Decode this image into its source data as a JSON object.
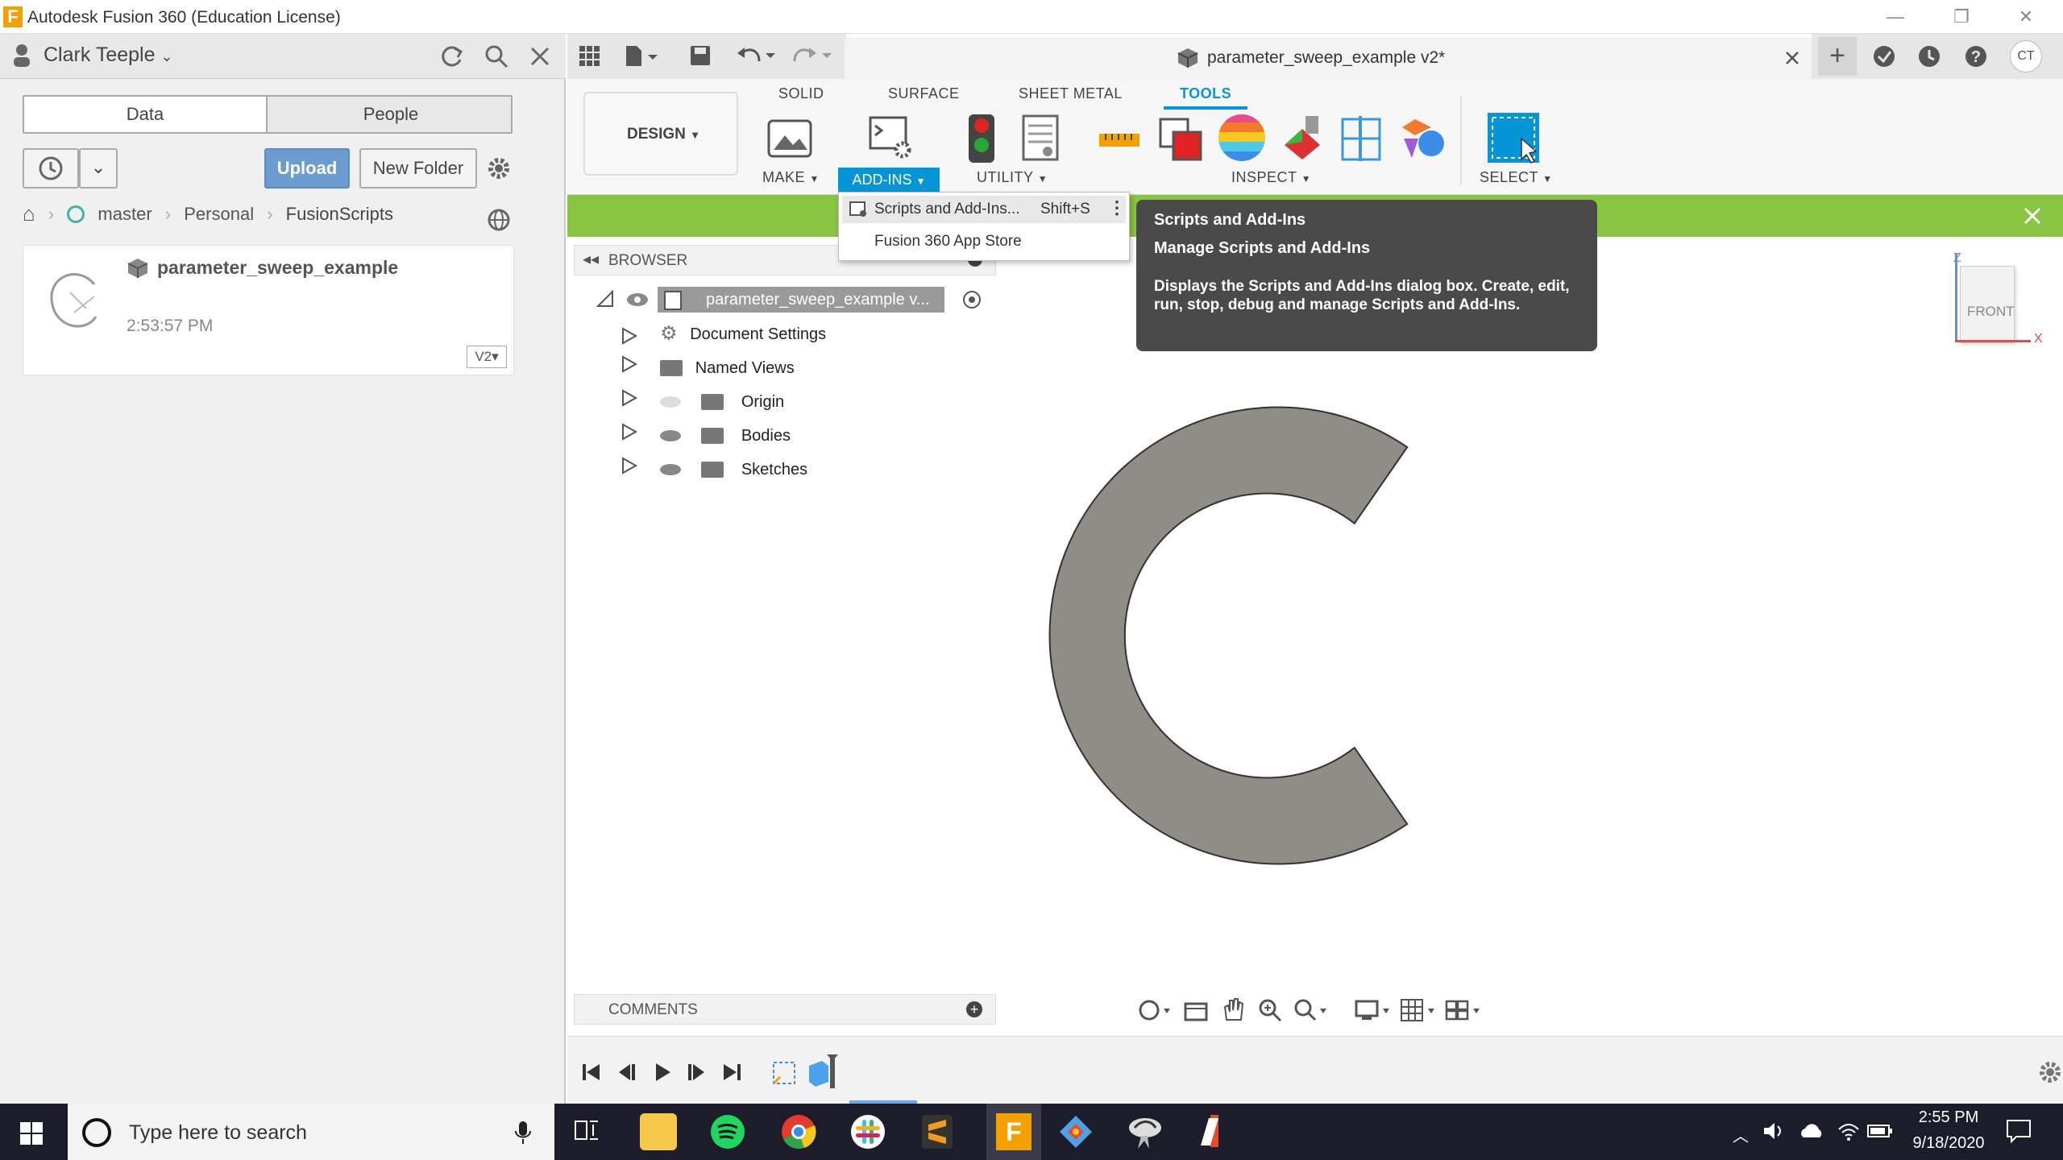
{
  "window": {
    "title": "Autodesk Fusion 360 (Education License)",
    "logo_letter": "F"
  },
  "left_panel": {
    "user": "Clark Teeple",
    "tabs": [
      "Data",
      "People"
    ],
    "upload_label": "Upload",
    "new_folder_label": "New Folder",
    "breadcrumb": [
      "master",
      "Personal",
      "FusionScripts"
    ],
    "file": {
      "name": "parameter_sweep_example",
      "time": "2:53:57 PM",
      "version": "V2"
    }
  },
  "document_tab": {
    "title": "parameter_sweep_example v2*"
  },
  "user_initials": "CT",
  "ribbon": {
    "workspace": "DESIGN",
    "tabs": [
      "SOLID",
      "SURFACE",
      "SHEET METAL",
      "TOOLS"
    ],
    "active_tab": "TOOLS",
    "groups": [
      "MAKE",
      "ADD-INS",
      "UTILITY",
      "INSPECT",
      "SELECT"
    ]
  },
  "addins_menu": {
    "items": [
      {
        "label": "Scripts and Add-Ins...",
        "shortcut": "Shift+S"
      },
      {
        "label": "Fusion 360 App Store"
      }
    ]
  },
  "tooltip": {
    "title": "Scripts and Add-Ins",
    "subtitle": "Manage Scripts and Add-Ins",
    "body": "Displays the Scripts and Add-Ins dialog box. Create, edit, run, stop, debug and manage Scripts and Add-Ins."
  },
  "browser": {
    "label": "BROWSER",
    "root": "parameter_sweep_example v...",
    "items": [
      "Document Settings",
      "Named Views",
      "Origin",
      "Bodies",
      "Sketches"
    ]
  },
  "comments_label": "COMMENTS",
  "viewcube": {
    "face": "FRONT",
    "z": "Z",
    "x": "X"
  },
  "taskbar": {
    "search_placeholder": "Type here to search",
    "time": "2:55 PM",
    "date": "9/18/2020"
  },
  "colors": {
    "green_bar": "#88c540",
    "accent_blue": "#0696d7",
    "body_gray": "#8f8d86"
  }
}
